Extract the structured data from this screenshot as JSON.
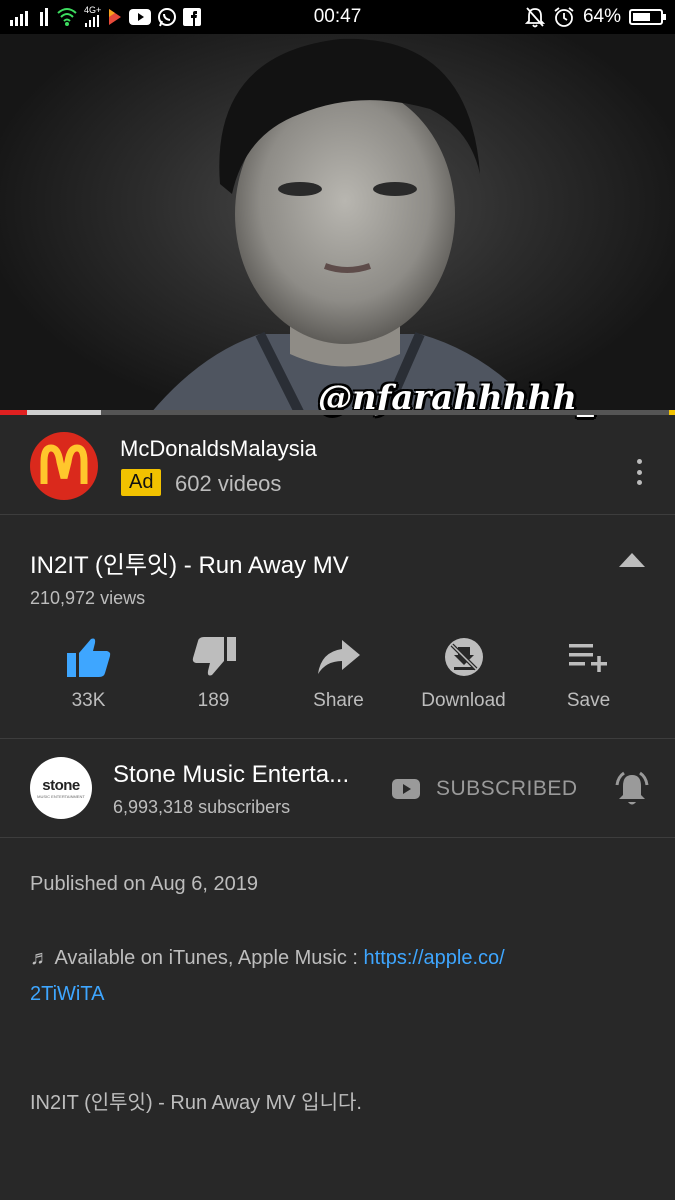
{
  "status_bar": {
    "time": "00:47",
    "battery_percent": "64%",
    "battery_level": 0.64,
    "network_label": "4G+",
    "icons": [
      "signal-icon",
      "signal-icon",
      "wifi-icon",
      "network-4g-icon",
      "app-icon",
      "youtube-icon",
      "whatsapp-icon",
      "facebook-icon",
      "mute-icon",
      "alarm-icon",
      "battery-icon"
    ]
  },
  "video": {
    "watermark": "@nfarahhhhh_",
    "progress_played": 0.04,
    "progress_buffered": 0.15
  },
  "ad": {
    "channel_name": "McDonaldsMalaysia",
    "badge": "Ad",
    "videos": "602 videos",
    "logo_color": "#da291c",
    "badge_color": "#f2c200"
  },
  "video_info": {
    "title": "IN2IT (인투잇) - Run Away MV",
    "views": "210,972 views"
  },
  "actions": [
    {
      "label": "33K",
      "icon": "thumbs-up-icon",
      "active": true
    },
    {
      "label": "189",
      "icon": "thumbs-down-icon"
    },
    {
      "label": "Share",
      "icon": "share-icon"
    },
    {
      "label": "Download",
      "icon": "download-disabled-icon"
    },
    {
      "label": "Save",
      "icon": "playlist-add-icon"
    }
  ],
  "channel": {
    "name": "Stone Music Enterta...",
    "subscribers": "6,993,318 subscribers",
    "logo_text": "stone",
    "logo_subtext": "MUSIC ENTERTAINMENT",
    "subscribe_label": "SUBSCRIBED"
  },
  "description": {
    "published": "Published on Aug 6, 2019",
    "line1_prefix": "♬ Available on iTunes, Apple Music : ",
    "link_part1": "https://apple.co/",
    "link_part2": "2TiWiTA",
    "line2": "IN2IT (인투잇) - Run Away MV 입니다."
  },
  "colors": {
    "background": "#282828",
    "accent_like": "#3ea6ff",
    "link": "#3ea6ff",
    "progress": "#e02020"
  }
}
